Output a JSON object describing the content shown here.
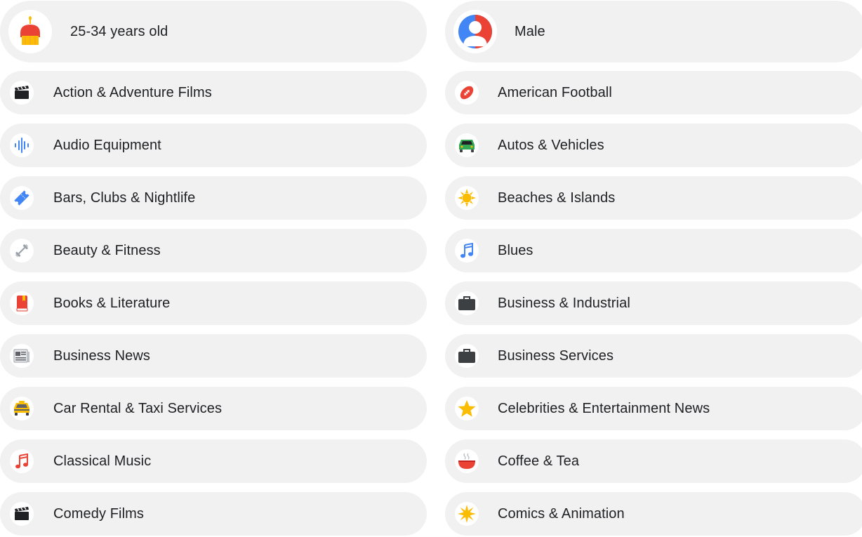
{
  "left": {
    "age": {
      "label": "25-34 years old",
      "icon": "birthday-cake-icon"
    },
    "items": [
      {
        "label": "Action & Adventure Films",
        "icon": "clapperboard-icon"
      },
      {
        "label": "Audio Equipment",
        "icon": "audio-waveform-icon"
      },
      {
        "label": "Bars, Clubs & Nightlife",
        "icon": "ticket-icon"
      },
      {
        "label": "Beauty & Fitness",
        "icon": "dumbbell-icon"
      },
      {
        "label": "Books & Literature",
        "icon": "book-icon"
      },
      {
        "label": "Business News",
        "icon": "newspaper-icon"
      },
      {
        "label": "Car Rental & Taxi Services",
        "icon": "taxi-icon"
      },
      {
        "label": "Classical Music",
        "icon": "music-note-icon"
      },
      {
        "label": "Comedy Films",
        "icon": "clapperboard-icon"
      }
    ]
  },
  "right": {
    "gender": {
      "label": "Male",
      "icon": "person-icon"
    },
    "items": [
      {
        "label": "American Football",
        "icon": "football-icon"
      },
      {
        "label": "Autos & Vehicles",
        "icon": "car-icon"
      },
      {
        "label": "Beaches & Islands",
        "icon": "sun-icon"
      },
      {
        "label": "Blues",
        "icon": "music-note-icon"
      },
      {
        "label": "Business & Industrial",
        "icon": "briefcase-icon"
      },
      {
        "label": "Business Services",
        "icon": "briefcase-icon"
      },
      {
        "label": "Celebrities & Entertainment News",
        "icon": "star-icon"
      },
      {
        "label": "Coffee & Tea",
        "icon": "coffee-cup-icon"
      },
      {
        "label": "Comics & Animation",
        "icon": "starburst-icon"
      }
    ]
  },
  "colors": {
    "pill_bg": "#f1f1f1",
    "text": "#202124",
    "google_blue": "#4285f4",
    "google_red": "#ea4335",
    "google_yellow": "#fbbc04",
    "google_green": "#34a853"
  }
}
